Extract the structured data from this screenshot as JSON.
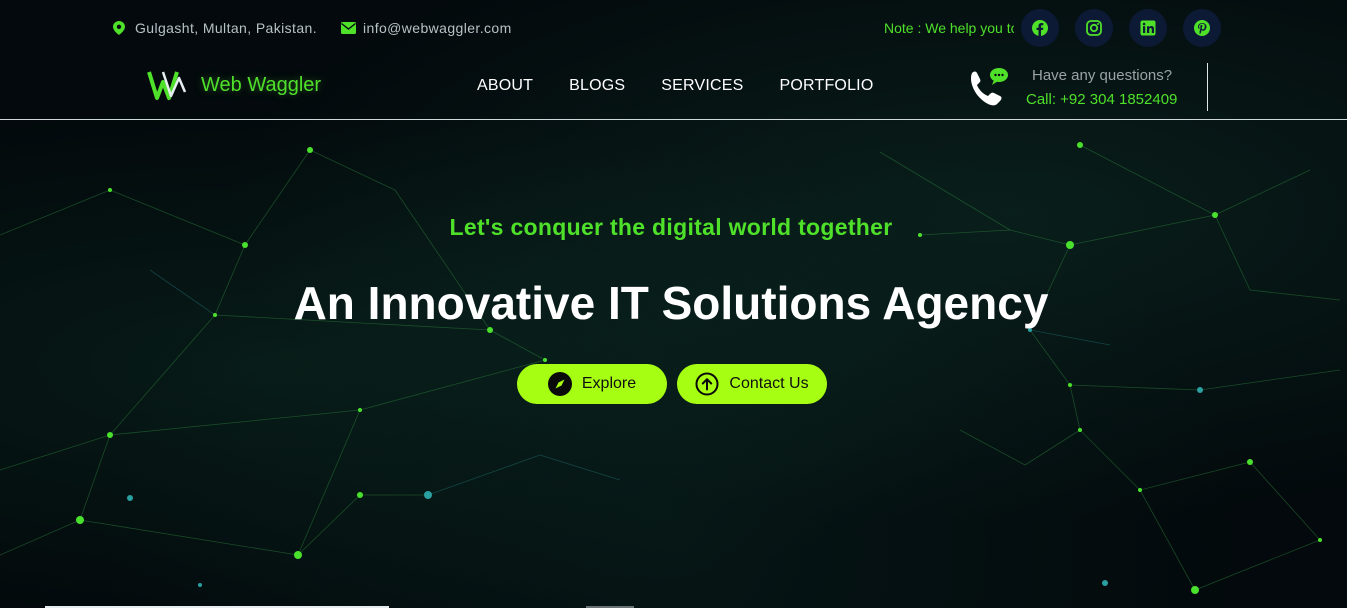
{
  "topbar": {
    "location": "Gulgasht, Multan, Pakistan.",
    "email": "info@webwaggler.com",
    "note": "Note : We help you to"
  },
  "social": [
    {
      "name": "facebook-icon"
    },
    {
      "name": "instagram-icon"
    },
    {
      "name": "linkedin-icon"
    },
    {
      "name": "pinterest-icon"
    }
  ],
  "brand": {
    "name": "Web Waggler"
  },
  "nav": {
    "items": [
      "ABOUT",
      "BLOGS",
      "SERVICES",
      "PORTFOLIO"
    ]
  },
  "contact": {
    "question": "Have any questions?",
    "call": "Call: +92 304 1852409"
  },
  "hero": {
    "tagline": "Let's conquer the digital world together",
    "headline": "An Innovative IT Solutions Agency",
    "explore_label": "Explore",
    "contact_label": "Contact Us"
  },
  "colors": {
    "accent": "#4fe02a",
    "button": "#a6ff13",
    "background": "#03090c",
    "social_bg": "#0c1a36"
  }
}
